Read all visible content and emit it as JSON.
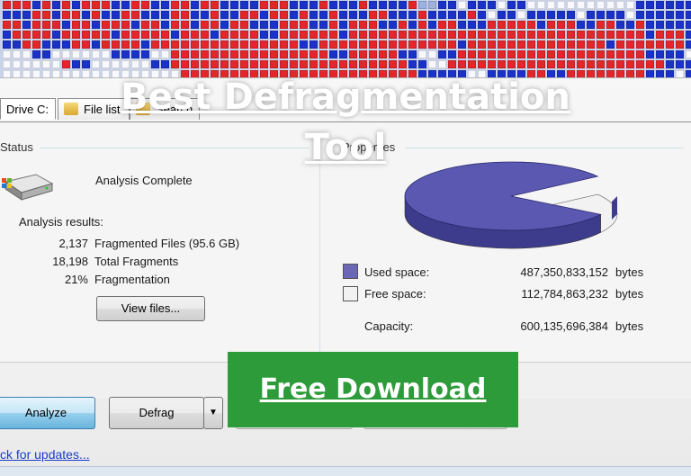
{
  "blockmap": {
    "legend_colors": {
      "fragmented": "#e3262a",
      "contiguous": "#1a32c8",
      "free": "#f8f8ff",
      "system": "#9fb0e0"
    }
  },
  "tabs": [
    {
      "label": "Drive C:"
    },
    {
      "label": "File list"
    },
    {
      "label": "Search"
    }
  ],
  "status": {
    "title": "Status",
    "state": "Analysis Complete",
    "results_heading": "Analysis results:",
    "rows": [
      {
        "value": "2,137",
        "label": "Fragmented Files (95.6 GB)"
      },
      {
        "value": "18,198",
        "label": "Total Fragments"
      },
      {
        "value": "21%",
        "label": "Fragmentation"
      }
    ],
    "view_files_label": "View files..."
  },
  "properties": {
    "title": "Properties",
    "used_label": "Used space:",
    "used_value": "487,350,833,152",
    "free_label": "Free space:",
    "free_value": "112,784,863,232",
    "capacity_label": "Capacity:",
    "capacity_value": "600,135,696,384",
    "unit": "bytes",
    "used_fraction": 0.812,
    "used_color": "#5a58b0",
    "free_color": "#f2f2f2"
  },
  "toolbar": {
    "analyze_label": "Analyze",
    "defrag_label": "Defrag",
    "dropdown_glyph": "▼"
  },
  "footer": {
    "updates_link": "ck for updates..."
  },
  "overlay": {
    "title": "Best Defragmentation Tool",
    "download_label": "Free Download "
  }
}
